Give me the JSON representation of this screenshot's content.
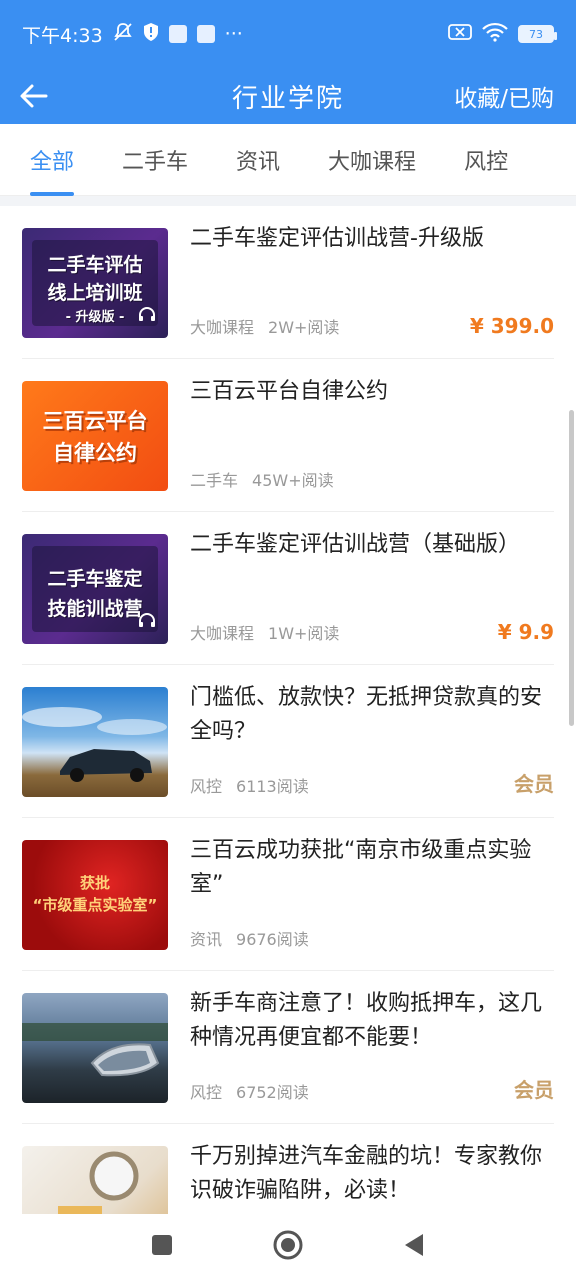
{
  "status_bar": {
    "time": "下午4:33",
    "ellipsis": "···",
    "battery": "73"
  },
  "header": {
    "title": "行业学院",
    "right_link": "收藏/已购"
  },
  "tabs": [
    {
      "label": "全部",
      "active": true
    },
    {
      "label": "二手车",
      "active": false
    },
    {
      "label": "资讯",
      "active": false
    },
    {
      "label": "大咖课程",
      "active": false
    },
    {
      "label": "风控",
      "active": false
    }
  ],
  "articles": [
    {
      "title": "二手车鉴定评估训战营-升级版",
      "category": "大咖课程",
      "reads": "2W+阅读",
      "price": "¥ 399.0",
      "thumb_lines": [
        "二手车评估",
        "线上培训班",
        "- 升级版 -"
      ]
    },
    {
      "title": "三百云平台自律公约",
      "category": "二手车",
      "reads": "45W+阅读",
      "thumb_lines": [
        "三百云平台",
        "自律公约"
      ]
    },
    {
      "title": "二手车鉴定评估训战营（基础版）",
      "category": "大咖课程",
      "reads": "1W+阅读",
      "price": "¥ 9.9",
      "thumb_lines": [
        "二手车鉴定",
        "技能训战营"
      ]
    },
    {
      "title": "门槛低、放款快？无抵押贷款真的安全吗？",
      "category": "风控",
      "reads": "6113阅读",
      "badge": "会员"
    },
    {
      "title": "三百云成功获批“南京市级重点实验室”",
      "category": "资讯",
      "reads": "9676阅读",
      "thumb_lines": [
        "获批",
        "“市级重点实验室”"
      ]
    },
    {
      "title": "新手车商注意了！收购抵押车，这几种情况再便宜都不能要！",
      "category": "风控",
      "reads": "6752阅读",
      "badge": "会员"
    },
    {
      "title": "千万别掉进汽车金融的坑！专家教你识破诈骗陷阱，必读！",
      "category": "",
      "reads": ""
    }
  ],
  "colors": {
    "primary": "#3a8ff2",
    "price": "#f07a1f",
    "member": "#c8a06a"
  }
}
